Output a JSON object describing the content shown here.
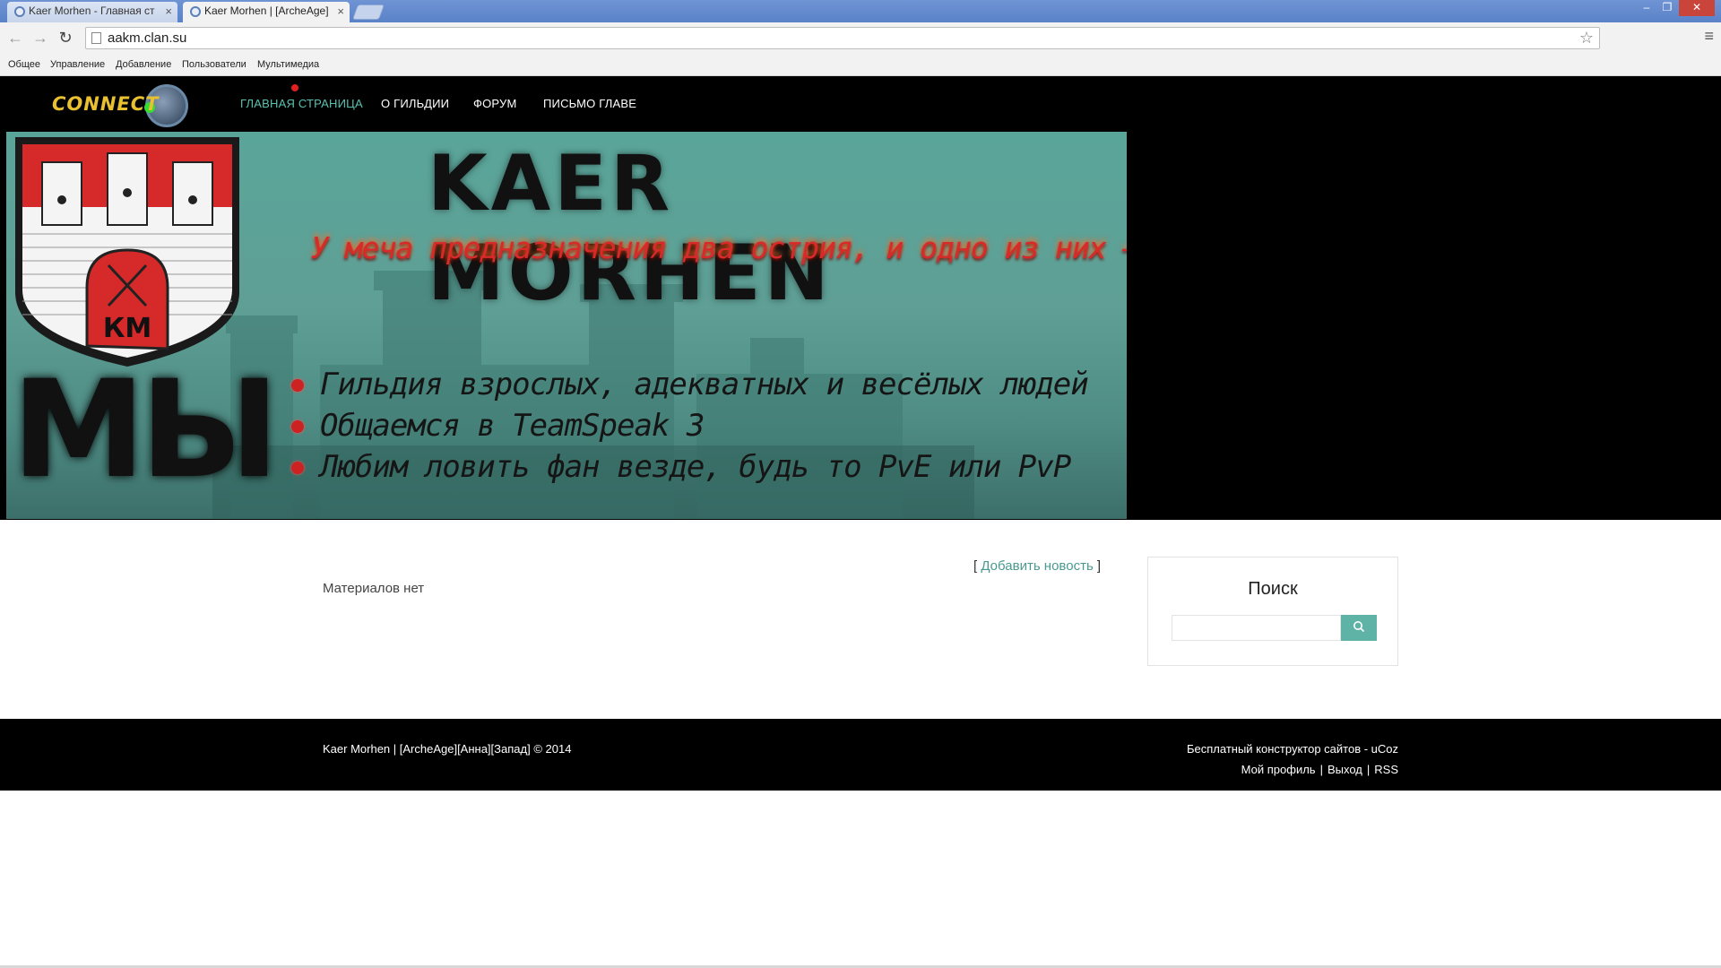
{
  "browser": {
    "tabs": [
      {
        "title": "Kaer Morhen - Главная ст",
        "active": false
      },
      {
        "title": "Kaer Morhen | [ArcheAge]",
        "active": true
      }
    ],
    "tab_close_glyph": "×",
    "url": "aakm.clan.su",
    "window_controls": [
      "–",
      "❐",
      "✕"
    ],
    "nav_glyphs": {
      "back": "←",
      "forward": "→",
      "reload": "↻",
      "star": "☆",
      "menu": "≡"
    }
  },
  "bookmarks": [
    "Общее",
    "Управление",
    "Добавление",
    "Пользователи",
    "Мультимедиа"
  ],
  "site": {
    "logo_text": "CONNECT",
    "nav": [
      {
        "label": "ГЛАВНАЯ СТРАНИЦА",
        "active": true
      },
      {
        "label": "О ГИЛЬДИИ",
        "active": false
      },
      {
        "label": "ФОРУМ",
        "active": false
      },
      {
        "label": "ПИСЬМО ГЛАВЕ",
        "active": false
      }
    ],
    "banner": {
      "title": "KAER MORHEN",
      "motto": "У меча предназначения два острия, и одно из них – ты!",
      "big_word": "МЫ",
      "shield_letters": "КМ",
      "bullets": [
        "Гильдия взрослых, адекватных и весёлых людей",
        "Общаемся в TeamSpeak 3",
        "Любим ловить фан везде, будь то PvE или PvP"
      ]
    }
  },
  "content": {
    "add_news_open": "[ ",
    "add_news_link": "Добавить новость",
    "add_news_close": " ]",
    "no_materials": "Материалов нет",
    "search": {
      "title": "Поиск",
      "placeholder": ""
    }
  },
  "footer": {
    "copyright": "Kaer Morhen | [ArcheAge][Анна][Запад] © 2014",
    "ucoz": "Бесплатный конструктор сайтов - uCoz",
    "links": [
      "Мой профиль",
      "Выход",
      "RSS"
    ],
    "separator": "|"
  },
  "colors": {
    "accent": "#5fb3a6",
    "nav_active": "#5cc0b0",
    "header_bg": "#000000"
  }
}
